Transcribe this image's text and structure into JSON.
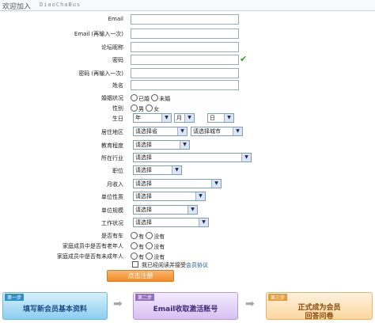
{
  "header": {
    "title": "欢迎加入",
    "subtitle": "DiaoChaBus"
  },
  "fields": {
    "email": "Email",
    "email_confirm": "Email (再输入一次)",
    "nickname": "论坛昵称",
    "password": "密码",
    "password_confirm": "密码 (再输入一次)",
    "name": "姓名",
    "marital": "婚姻状况",
    "gender": "性别",
    "birthday": "生日",
    "residence": "居住地区",
    "education": "教育程度",
    "industry": "所在行业",
    "position": "职位",
    "income": "月收入",
    "company_type": "单位性质",
    "company_size": "单位规模",
    "work_status": "工作状况",
    "has_car": "是否有车",
    "has_elderly": "家庭成员中是否有老年人",
    "has_minor": "家庭成员中是否有未成年人"
  },
  "options": {
    "married": "已婚",
    "unmarried": "未婚",
    "male": "男",
    "female": "女",
    "yes": "有",
    "no": "没有",
    "year": "年",
    "month": "月",
    "day": "日",
    "province": "请选择省",
    "city": "请选择城市",
    "choose": "请选择"
  },
  "agree": {
    "prefix": "我已经阅读并接受",
    "link": "会员协议"
  },
  "submit_label": "点击注册",
  "steps": [
    {
      "tag": "第一步",
      "text": "填写新会员基本资料"
    },
    {
      "tag": "第二步",
      "text": "Email收取激活账号"
    },
    {
      "tag": "第三步",
      "text": "正式成为会员",
      "text2": "回答问卷"
    }
  ],
  "icons": {
    "valid": "check-icon",
    "dropdown": "dropdown-arrow-icon",
    "flow": "arrow-right-icon"
  },
  "colors": {
    "check": "#3a9a2a",
    "submit": "#f08b2c",
    "link": "#225599"
  }
}
